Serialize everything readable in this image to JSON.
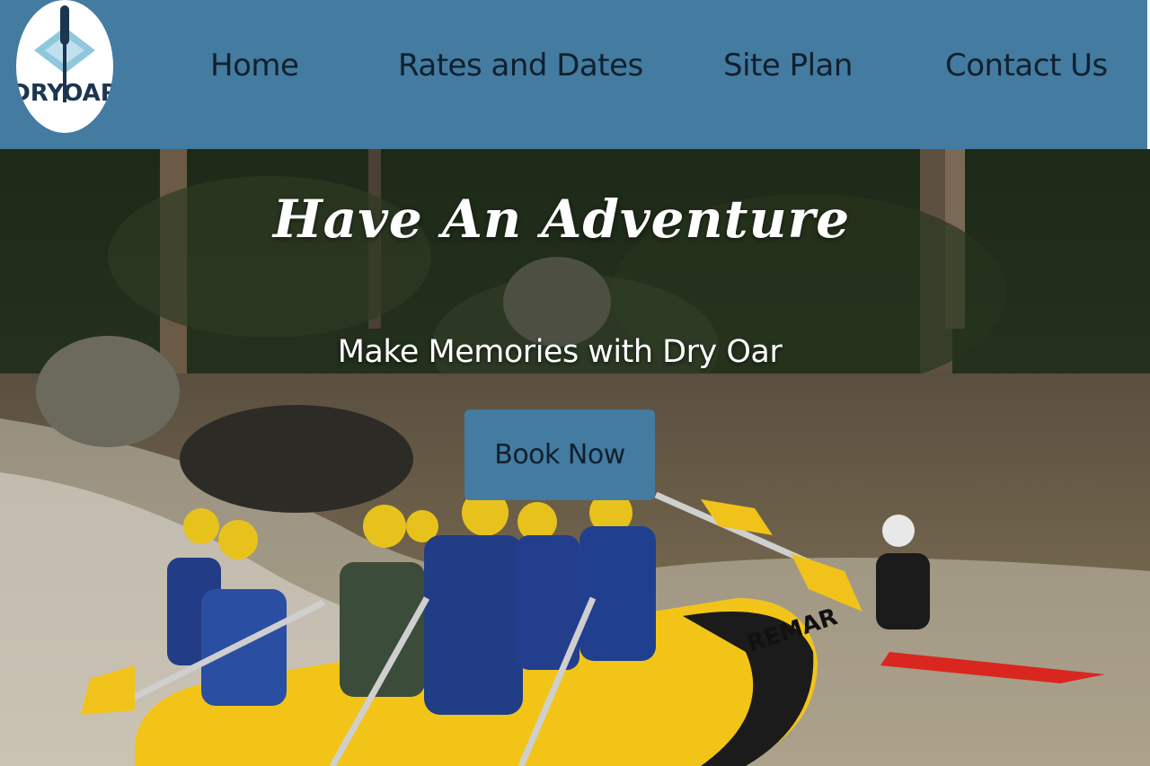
{
  "brand": {
    "logo_text": "DRYOAR"
  },
  "nav": {
    "home": "Home",
    "rates": "Rates and Dates",
    "siteplan": "Site Plan",
    "contact": "Contact Us"
  },
  "hero": {
    "title": "Have An Adventure",
    "subtitle": "Make Memories with Dry Oar",
    "cta": "Book Now",
    "raft_text": "REMAR"
  },
  "colors": {
    "header_bg": "#447ba0",
    "button_bg": "#447ba0",
    "nav_text": "#10202e",
    "hero_text": "#ffffff"
  }
}
